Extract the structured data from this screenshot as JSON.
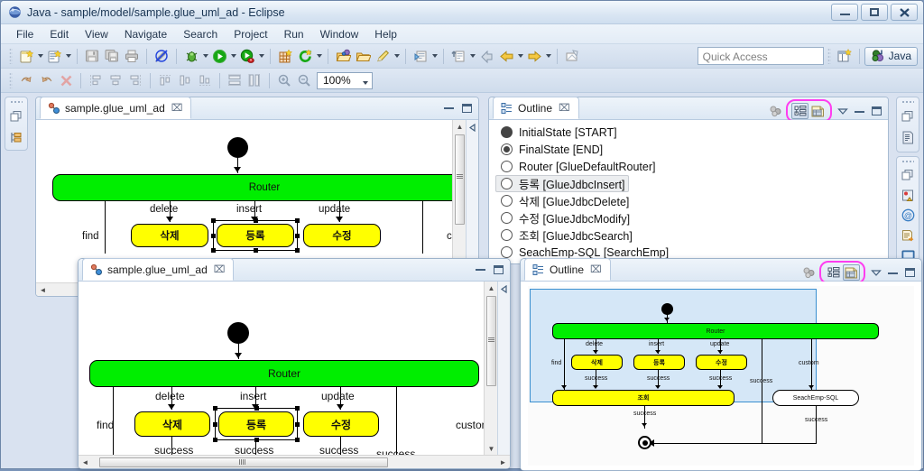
{
  "window": {
    "title": "Java - sample/model/sample.glue_uml_ad - Eclipse",
    "icon": "eclipse-globe-icon",
    "minimize": "–",
    "restore": "▣",
    "close": "✕"
  },
  "menubar": {
    "items": [
      "File",
      "Edit",
      "View",
      "Navigate",
      "Search",
      "Project",
      "Run",
      "Window",
      "Help"
    ]
  },
  "toolbar": {
    "zoom_level": "100%",
    "row1_icons": [
      "new-wizard-icon",
      "new-java-project-icon",
      "save-icon",
      "save-all-icon",
      "print-icon",
      "no-edit-icon",
      "debug-icon",
      "run-icon",
      "run-coverage-icon",
      "new-plugin-icon",
      "refresh-icon",
      "open-type-icon",
      "open-resource-icon",
      "edit-pencil-icon",
      "external-tools-icon",
      "next-annotation-icon",
      "previous-edit-icon",
      "back-icon",
      "forward-icon",
      "link-editor-icon"
    ],
    "row2_icons": [
      "undo-icon",
      "redo-icon",
      "delete-icon",
      "align-left-icon",
      "align-center-icon",
      "align-right-icon",
      "align-top-icon",
      "align-middle-icon",
      "align-bottom-icon",
      "match-height-icon",
      "match-width-icon",
      "zoom-in-icon",
      "zoom-out-icon"
    ]
  },
  "quick_access": {
    "placeholder": "Quick Access",
    "value": ""
  },
  "perspective": {
    "open_perspective_icon": "open-perspective-icon",
    "current": "Java",
    "icon": "java-perspective-icon"
  },
  "left_fastview": {
    "icons": [
      "restore-icon",
      "package-explorer-icon"
    ]
  },
  "right_fastview": {
    "group1": [
      "restore-icon",
      "outline-doc-icon"
    ],
    "group2": [
      "restore-icon",
      "problems-icon",
      "javadoc-icon",
      "declaration-icon",
      "console-icon"
    ]
  },
  "editor_back": {
    "tab_label": "sample.glue_uml_ad",
    "tab_icon": "uml-activity-diagram-icon",
    "close_glyph": "⌧",
    "minimize_glyph": "–",
    "maximize_glyph": "□"
  },
  "editor_front": {
    "tab_label": "sample.glue_uml_ad",
    "tab_icon": "uml-activity-diagram-icon",
    "close_glyph": "⌧",
    "minimize_glyph": "–",
    "maximize_glyph": "□"
  },
  "outline_tree": {
    "tab_label": "Outline",
    "tab_icon": "outline-icon",
    "close_glyph": "⌧",
    "menu_glyph": "▽",
    "minimize_glyph": "–",
    "maximize_glyph": "□",
    "filter_icon": "hide-non-public-icon",
    "highlight_color": "#ff3df0",
    "buttons": [
      {
        "name": "tree-view-button",
        "icon": "tree-outline-icon",
        "pressed": true
      },
      {
        "name": "thumbnail-view-button",
        "icon": "thumbnail-outline-icon",
        "pressed": false
      }
    ],
    "items": [
      {
        "shape": "filled-circle",
        "name": "InitialState",
        "type": "[START]",
        "selected": false
      },
      {
        "shape": "ring-circle",
        "name": "FinalState",
        "type": "[END]",
        "selected": false
      },
      {
        "shape": "circle",
        "name": "Router",
        "type": "[GlueDefaultRouter]",
        "selected": false
      },
      {
        "shape": "circle",
        "name": "등록",
        "type": "[GlueJdbcInsert]",
        "selected": true
      },
      {
        "shape": "circle",
        "name": "삭제",
        "type": "[GlueJdbcDelete]",
        "selected": false
      },
      {
        "shape": "circle",
        "name": "수정",
        "type": "[GlueJdbcModify]",
        "selected": false
      },
      {
        "shape": "circle",
        "name": "조회",
        "type": "[GlueJdbcSearch]",
        "selected": false
      },
      {
        "shape": "circle",
        "name": "SeachEmp-SQL",
        "type": "[SearchEmp]",
        "selected": false
      }
    ]
  },
  "outline_thumb": {
    "tab_label": "Outline",
    "tab_icon": "outline-icon",
    "close_glyph": "⌧",
    "menu_glyph": "▽",
    "minimize_glyph": "–",
    "maximize_glyph": "□",
    "filter_icon": "hide-non-public-icon",
    "highlight_color": "#ff3df0",
    "buttons": [
      {
        "name": "tree-view-button",
        "icon": "tree-outline-icon",
        "pressed": false
      },
      {
        "name": "thumbnail-view-button",
        "icon": "thumbnail-outline-icon",
        "pressed": true
      }
    ]
  },
  "diagram": {
    "router_label": "Router",
    "start_label": "",
    "transitions": {
      "find": "find",
      "delete": "delete",
      "insert": "insert",
      "update": "update",
      "custom": "custom",
      "success": "success"
    },
    "activities": {
      "delete": "삭제",
      "insert": "등록",
      "update": "수정",
      "search": "조회",
      "sql": "SeachEmp-SQL"
    },
    "selected_activity": "등록",
    "colors": {
      "router_fill": "#00ee00",
      "activity_fill": "#ffff00",
      "selection_box": "#3a8fd0"
    }
  },
  "scrollbars": {
    "up_arrow": "▲",
    "down_arrow": "▼",
    "left_arrow": "◄",
    "right_arrow": "►",
    "grip": "‖"
  }
}
